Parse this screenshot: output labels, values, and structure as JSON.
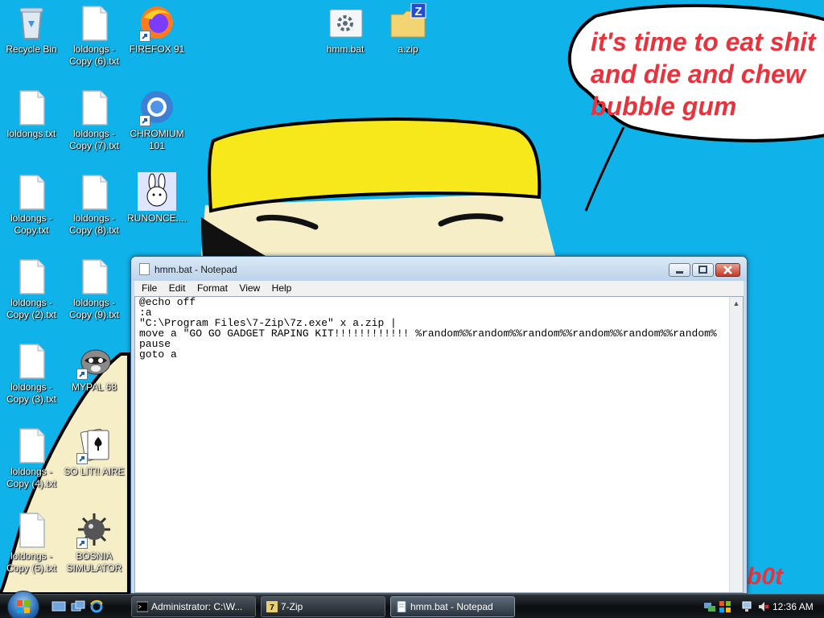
{
  "desktop": {
    "icons": [
      {
        "label": "Recycle Bin",
        "icon": "recycle-bin-icon"
      },
      {
        "label": "loldongs - Copy (6).txt",
        "icon": "text-file-icon"
      },
      {
        "label": "FIREFOX 91",
        "icon": "firefox-icon"
      },
      {
        "label": "hmm.bat",
        "icon": "batch-file-icon"
      },
      {
        "label": "a.zip",
        "icon": "zip-folder-icon"
      },
      {
        "label": "loldongs.txt",
        "icon": "text-file-icon"
      },
      {
        "label": "loldongs - Copy (7).txt",
        "icon": "text-file-icon"
      },
      {
        "label": "CHROMIUM 101",
        "icon": "chromium-icon"
      },
      {
        "label": "loldongs - Copy.txt",
        "icon": "text-file-icon"
      },
      {
        "label": "loldongs - Copy (8).txt",
        "icon": "text-file-icon"
      },
      {
        "label": "RUNONCE....",
        "icon": "bunny-icon"
      },
      {
        "label": "loldongs - Copy (2).txt",
        "icon": "text-file-icon"
      },
      {
        "label": "loldongs - Copy (9).txt",
        "icon": "text-file-icon"
      },
      {
        "label": "loldongs - Copy (3).txt",
        "icon": "text-file-icon"
      },
      {
        "label": "MYPAL 68",
        "icon": "raccoon-icon"
      },
      {
        "label": "loldongs - Copy (4).txt",
        "icon": "text-file-icon"
      },
      {
        "label": "SO LIT!! AIRE",
        "icon": "solitaire-icon"
      },
      {
        "label": "loldongs - Copy (5).txt",
        "icon": "text-file-icon"
      },
      {
        "label": "BOSNIA SIMULATOR",
        "icon": "minesweeper-icon"
      }
    ]
  },
  "wallpaper": {
    "speech_bubble_text": "it's time to eat shit\nand die and chew\nbubble gum",
    "signature": "b0t",
    "text_color": "#e8323c",
    "background_color": "#0fb3ea",
    "hat_color": "#f7e81c"
  },
  "notepad": {
    "title": "hmm.bat - Notepad",
    "menu": [
      "File",
      "Edit",
      "Format",
      "View",
      "Help"
    ],
    "content": "@echo off\n:a\n\"C:\\Program Files\\7-Zip\\7z.exe\" x a.zip |\nmove a \"GO GO GADGET RAPING KIT!!!!!!!!!!!! %random%%random%%random%%random%%random%%random%\npause\ngoto a"
  },
  "taskbar": {
    "quick_launch": [
      "show-desktop-icon",
      "switch-windows-icon",
      "internet-explorer-icon"
    ],
    "tasks": [
      {
        "label": "Administrator: C:\\W...",
        "icon": "cmd-icon"
      },
      {
        "label": "7-Zip",
        "icon": "7zip-icon"
      },
      {
        "label": "hmm.bat - Notepad",
        "icon": "notepad-icon"
      }
    ],
    "tray_icons": [
      "network-icon",
      "security-icon",
      "network-status-icon",
      "volume-muted-icon"
    ],
    "clock": "12:36 AM"
  }
}
